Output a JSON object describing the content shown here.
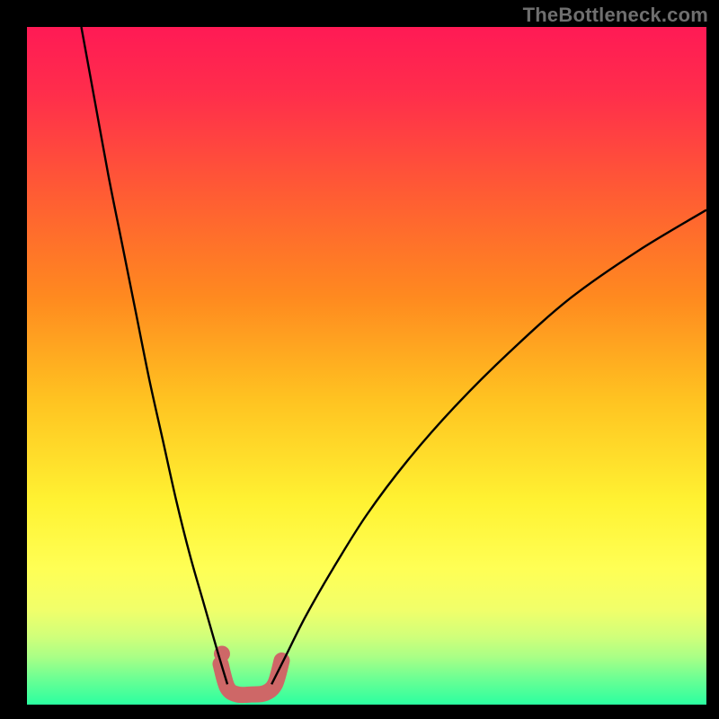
{
  "watermark": "TheBottleneck.com",
  "chart_data": {
    "type": "line",
    "title": "",
    "xlabel": "",
    "ylabel": "",
    "xlim": [
      0,
      100
    ],
    "ylim": [
      0,
      100
    ],
    "grid": false,
    "annotations": [],
    "background": {
      "type": "vertical-gradient",
      "stops": [
        {
          "pos": 0.0,
          "color": "#ff1a55"
        },
        {
          "pos": 0.1,
          "color": "#ff2e4b"
        },
        {
          "pos": 0.25,
          "color": "#ff5d33"
        },
        {
          "pos": 0.4,
          "color": "#ff8a1f"
        },
        {
          "pos": 0.55,
          "color": "#ffc321"
        },
        {
          "pos": 0.7,
          "color": "#fff232"
        },
        {
          "pos": 0.8,
          "color": "#ffff55"
        },
        {
          "pos": 0.86,
          "color": "#f1ff6a"
        },
        {
          "pos": 0.9,
          "color": "#d0ff7a"
        },
        {
          "pos": 0.93,
          "color": "#a9ff86"
        },
        {
          "pos": 0.96,
          "color": "#6fff93"
        },
        {
          "pos": 1.0,
          "color": "#2bffa0"
        }
      ]
    },
    "series": [
      {
        "name": "bottleneck-left",
        "x": [
          8,
          10,
          12,
          14,
          16,
          18,
          20,
          22,
          24,
          26,
          28,
          29.5
        ],
        "y": [
          100,
          89,
          78,
          68,
          58,
          48,
          39,
          30,
          22,
          15,
          8,
          3
        ]
      },
      {
        "name": "bottleneck-right",
        "x": [
          36,
          38,
          41,
          45,
          50,
          56,
          63,
          71,
          80,
          90,
          100
        ],
        "y": [
          3,
          7,
          13,
          20,
          28,
          36,
          44,
          52,
          60,
          67,
          73
        ]
      },
      {
        "name": "sweet-spot-band",
        "x": [
          28.5,
          29.5,
          31,
          33,
          35,
          36.5,
          37.5
        ],
        "y": [
          6.0,
          2.5,
          1.5,
          1.5,
          1.7,
          3.0,
          6.5
        ]
      }
    ],
    "styles": {
      "bottleneck-left": {
        "stroke": "#000000",
        "width": 2.4
      },
      "bottleneck-right": {
        "stroke": "#000000",
        "width": 2.4
      },
      "sweet-spot-band": {
        "stroke": "#ce6767",
        "width": 18,
        "linecap": "round"
      }
    },
    "sweet_spot_dot": {
      "x": 28.7,
      "y": 7.5,
      "r": 9,
      "color": "#ce6767"
    }
  }
}
